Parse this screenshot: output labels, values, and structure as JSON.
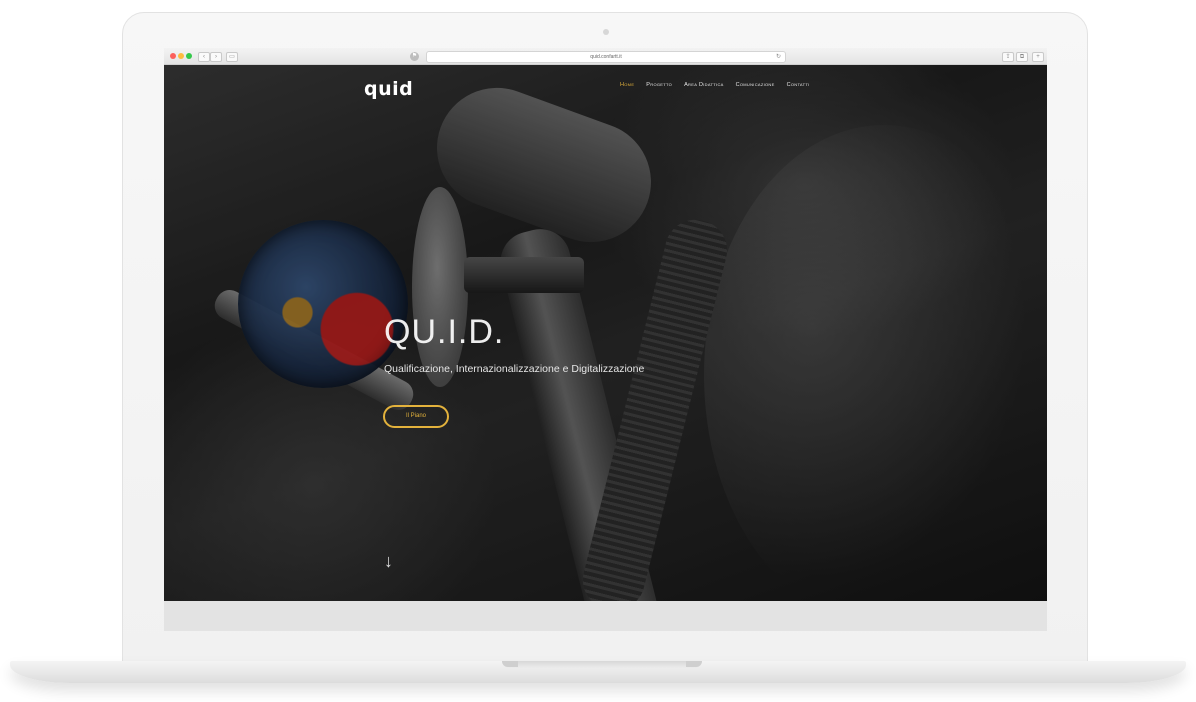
{
  "browser": {
    "url": "quid.confartt.it",
    "reload_icon": "reload-icon",
    "back_label": "‹",
    "forward_label": "›",
    "sidebar_label": "▭",
    "share_label": "⇪",
    "tabs_label": "⧉",
    "shield_label": "⚑"
  },
  "site": {
    "logo": "quid",
    "nav": [
      "Home",
      "Progetto",
      "Area Didattica",
      "Comunicazione",
      "Contatti"
    ],
    "active_nav": "Home"
  },
  "hero": {
    "title": "QU.I.D.",
    "subtitle": "Qualificazione, Internazionalizzazione e Digitalizzazione",
    "button": "Il Piano",
    "scroll_icon": "↓"
  },
  "colors": {
    "accent": "#e3b23c",
    "nav_text": "#e8e8e8",
    "hero_bg": "#1f1f1f"
  }
}
